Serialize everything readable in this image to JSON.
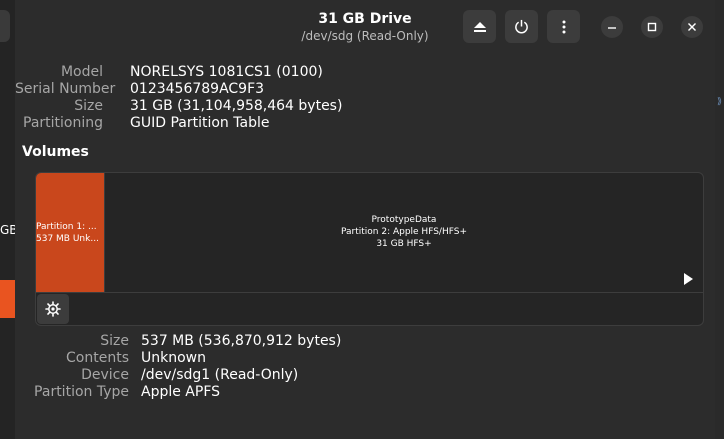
{
  "window": {
    "title": "31 GB Drive",
    "subtitle": "/dev/sdg (Read-Only)"
  },
  "sidebar": {
    "partial_label": "GB"
  },
  "drive": {
    "model_label": "Model",
    "model_value": "NORELSYS 1081CS1 (0100)",
    "serial_label": "Serial Number",
    "serial_value": "0123456789AC9F3",
    "size_label": "Size",
    "size_value": "31 GB (31,104,958,464 bytes)",
    "partitioning_label": "Partitioning",
    "partitioning_value": "GUID Partition Table"
  },
  "volumes": {
    "heading": "Volumes",
    "partition1": {
      "line1": "Partition 1: ...",
      "line2": "537 MB Unk..."
    },
    "partition2": {
      "line1": "PrototypeData",
      "line2": "Partition 2: Apple HFS/HFS+",
      "line3": "31 GB HFS+"
    }
  },
  "selected": {
    "size_label": "Size",
    "size_value": "537 MB (536,870,912 bytes)",
    "contents_label": "Contents",
    "contents_value": "Unknown",
    "device_label": "Device",
    "device_value": "/dev/sdg1 (Read-Only)",
    "ptype_label": "Partition Type",
    "ptype_value": "Apple APFS"
  },
  "icons": {
    "eject": "eject-icon",
    "power": "power-icon",
    "menu": "kebab-menu-icon",
    "minimize": "minimize-icon",
    "maximize": "maximize-icon",
    "close": "close-icon",
    "gear": "gear-icon",
    "play": "play-icon"
  },
  "colors": {
    "accent": "#e95420",
    "partition_selected": "#c9471c"
  }
}
